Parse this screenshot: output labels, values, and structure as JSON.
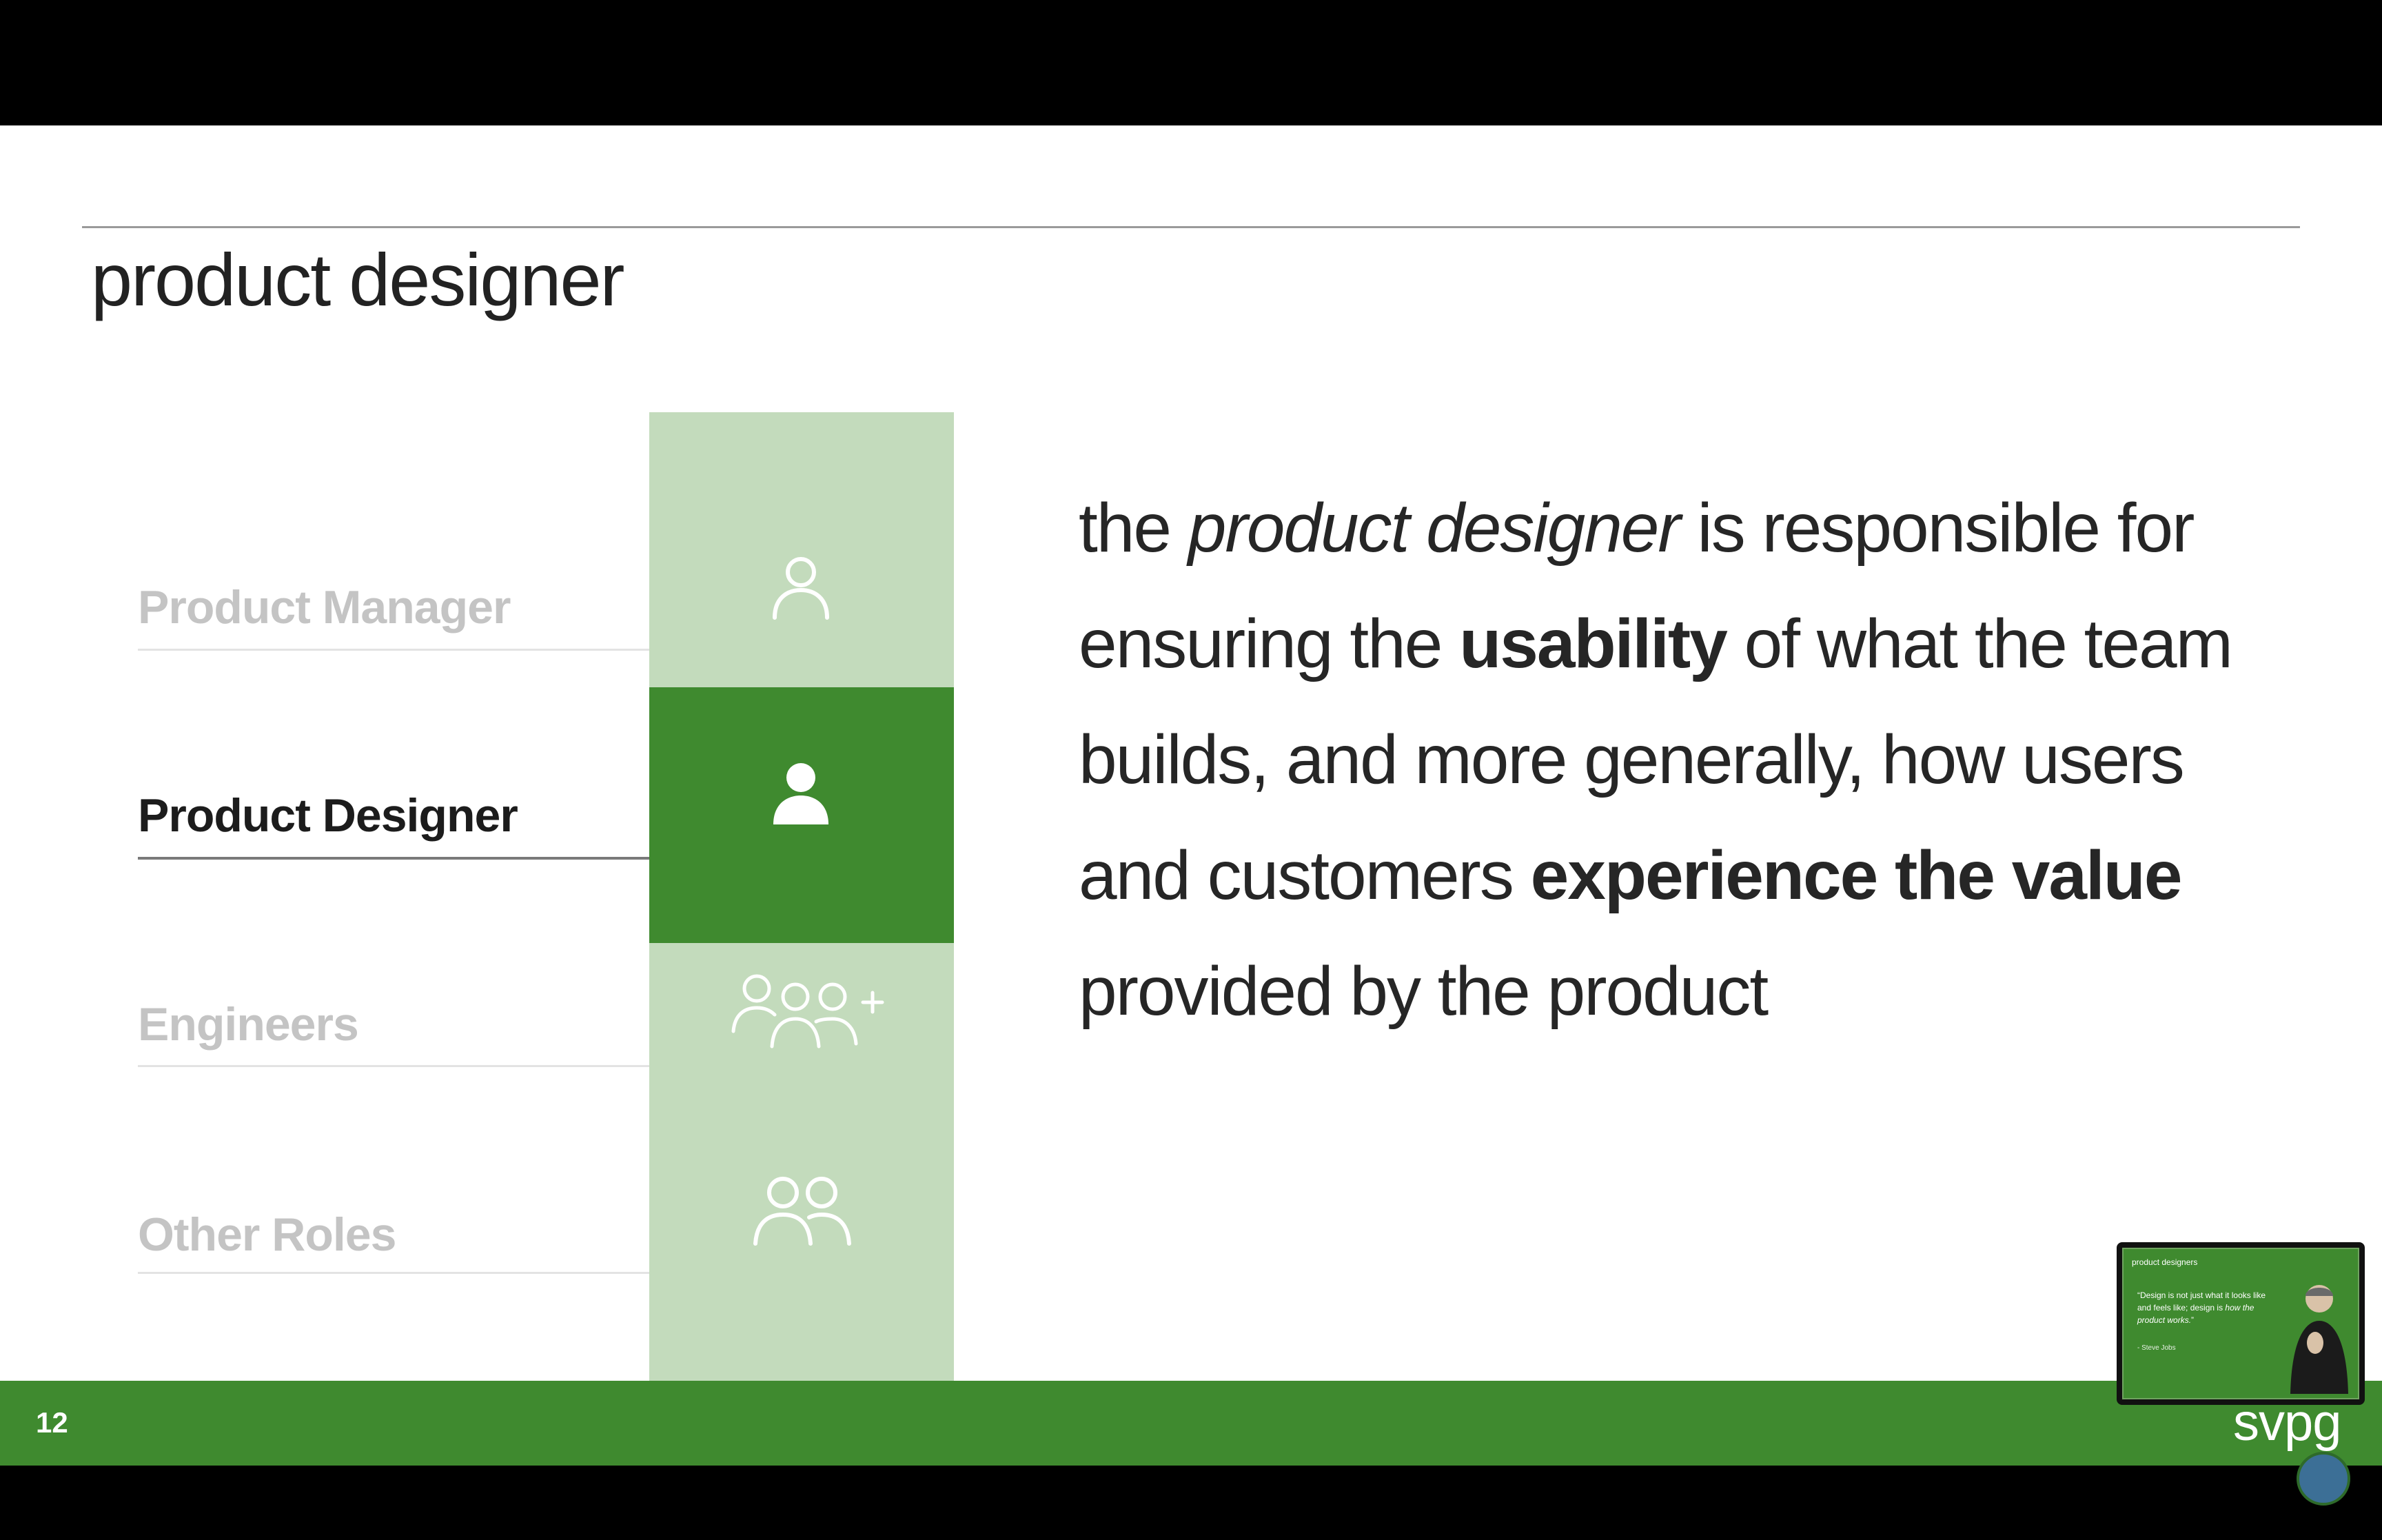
{
  "slide": {
    "title": "product designer",
    "page_number": "12",
    "logo": "svpg"
  },
  "roles": [
    {
      "label": "Product Manager",
      "icon": "user-outline-icon",
      "active": false
    },
    {
      "label": "Product Designer",
      "icon": "user-filled-icon",
      "active": true
    },
    {
      "label": "Engineers",
      "icon": "group-add-icon",
      "active": false
    },
    {
      "label": "Other Roles",
      "icon": "two-users-icon",
      "active": false
    }
  ],
  "description": {
    "t1": "the ",
    "t2": "product designer",
    "t3": " is responsible for ensuring the ",
    "t4": "usability",
    "t5": " of what the team builds, and more generally, how users and customers ",
    "t6": "experience the value",
    "t7": " provided by the product"
  },
  "thumbnail": {
    "title": "product designers",
    "quote_a": "“Design is not just what it looks like and feels like; design is ",
    "quote_b": "how the product works.",
    "quote_c": "”",
    "author": "- Steve Jobs"
  },
  "colors": {
    "brand_green": "#3f8a2f",
    "light_green": "#c3dbbc"
  }
}
